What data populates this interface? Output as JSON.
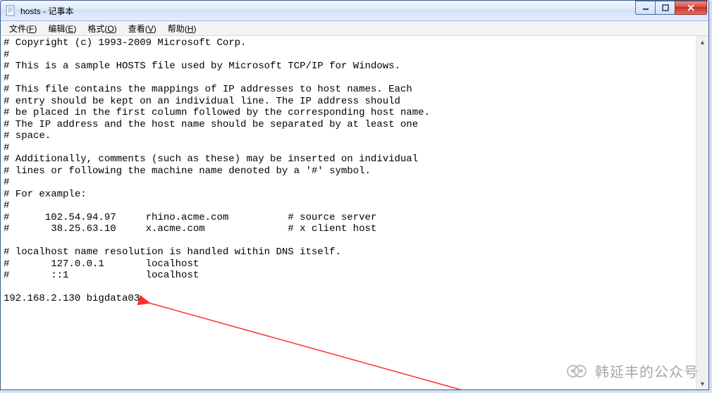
{
  "window": {
    "title": "hosts - 记事本"
  },
  "menu": {
    "file": {
      "label": "文件",
      "accel": "F"
    },
    "edit": {
      "label": "编辑",
      "accel": "E"
    },
    "format": {
      "label": "格式",
      "accel": "O"
    },
    "view": {
      "label": "查看",
      "accel": "V"
    },
    "help": {
      "label": "帮助",
      "accel": "H"
    }
  },
  "content": {
    "text": "# Copyright (c) 1993-2009 Microsoft Corp.\n#\n# This is a sample HOSTS file used by Microsoft TCP/IP for Windows.\n#\n# This file contains the mappings of IP addresses to host names. Each\n# entry should be kept on an individual line. The IP address should\n# be placed in the first column followed by the corresponding host name.\n# The IP address and the host name should be separated by at least one\n# space.\n#\n# Additionally, comments (such as these) may be inserted on individual\n# lines or following the machine name denoted by a '#' symbol.\n#\n# For example:\n#\n#      102.54.94.97     rhino.acme.com          # source server\n#       38.25.63.10     x.acme.com              # x client host\n\n# localhost name resolution is handled within DNS itself.\n#       127.0.0.1       localhost\n#       ::1             localhost\n\n192.168.2.130 bigdata03"
  },
  "watermark": {
    "text": "韩延丰的公众号"
  },
  "icons": {
    "notepad": "notepad-icon",
    "minimize": "minimize-icon",
    "maximize": "maximize-icon",
    "close": "close-icon",
    "scroll_up": "scroll-up-icon",
    "scroll_down": "scroll-down-icon",
    "wechat": "wechat-icon"
  }
}
